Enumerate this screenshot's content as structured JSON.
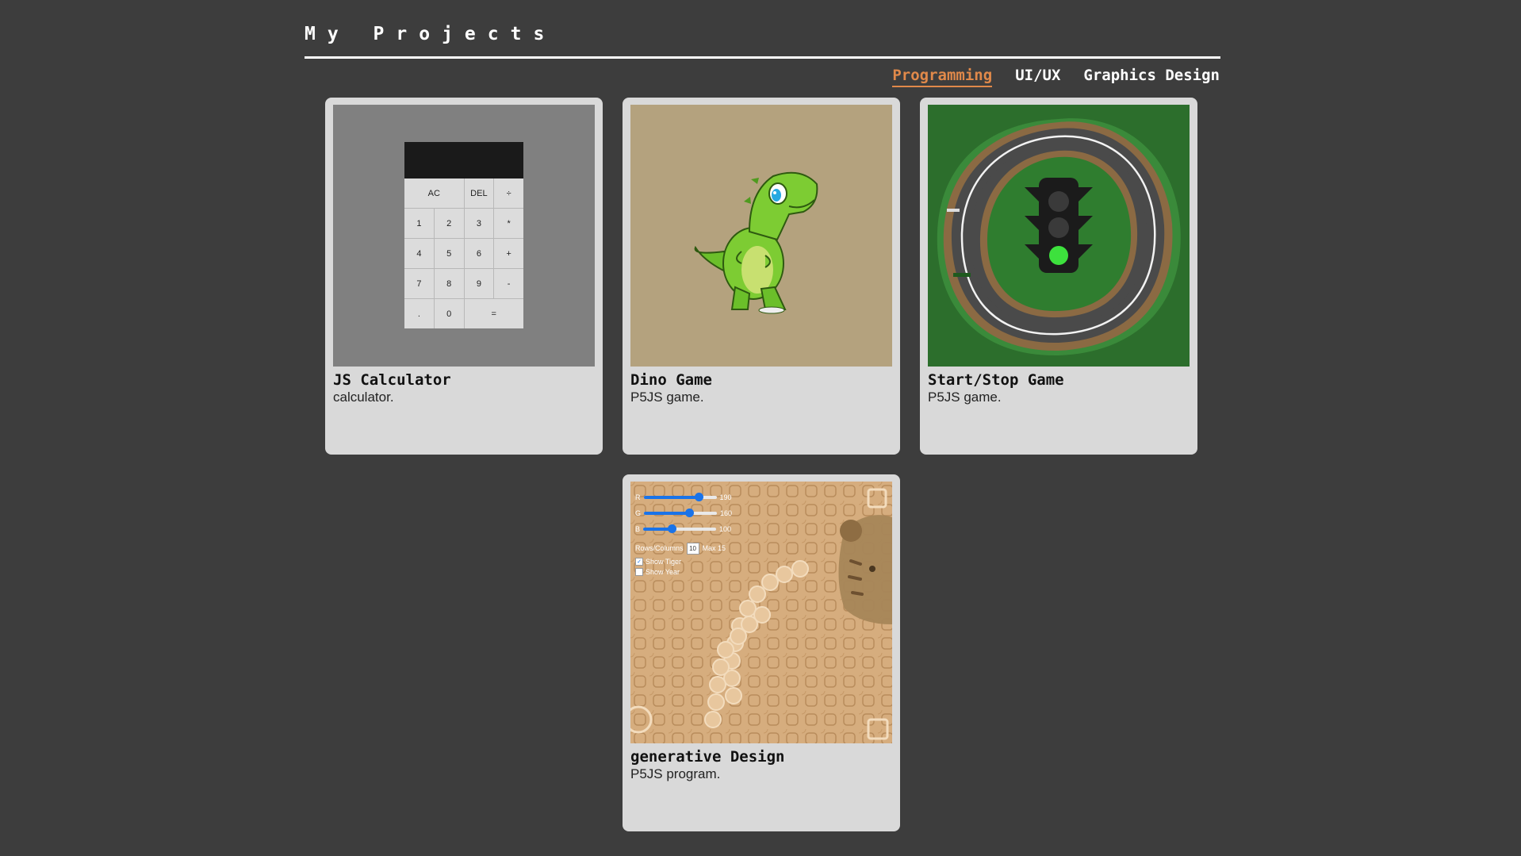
{
  "header": {
    "title": "My Projects"
  },
  "tabs": [
    {
      "label": "Programming",
      "active": true
    },
    {
      "label": "UI/UX",
      "active": false
    },
    {
      "label": "Graphics Design",
      "active": false
    }
  ],
  "colors": {
    "background": "#3d3d3d",
    "accent": "#e0894a",
    "card": "#d9d9d9"
  },
  "projects": [
    {
      "title": "JS Calculator",
      "description": "calculator."
    },
    {
      "title": "Dino Game",
      "description": "P5JS game."
    },
    {
      "title": "Start/Stop Game",
      "description": "P5JS game."
    },
    {
      "title": "generative Design",
      "description": "P5JS program."
    }
  ],
  "calculator": {
    "keys": [
      "AC",
      "DEL",
      "÷",
      "1",
      "2",
      "3",
      "*",
      "4",
      "5",
      "6",
      "+",
      "7",
      "8",
      "9",
      "-",
      ".",
      "0",
      "="
    ]
  },
  "generative": {
    "sliders": [
      {
        "label": "R",
        "value": "190",
        "fraction": 0.75
      },
      {
        "label": "G",
        "value": "160",
        "fraction": 0.62
      },
      {
        "label": "B",
        "value": "100",
        "fraction": 0.39
      }
    ],
    "rows_label": "Rows/Columns",
    "rows_value": "10",
    "max_label": "Max 15",
    "show_tiger": "Show Tiger",
    "show_year": "Show Year"
  }
}
